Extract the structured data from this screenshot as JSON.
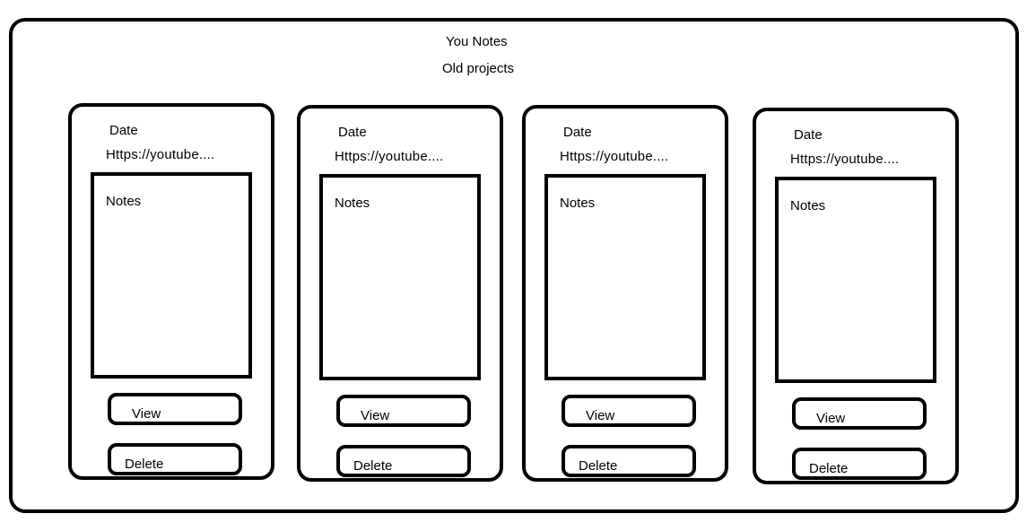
{
  "header": {
    "app_title": "You Notes",
    "section_title": "Old projects"
  },
  "cards": [
    {
      "date_label": "Date",
      "url": "Https://youtube....",
      "notes_label": "Notes",
      "view_label": "View",
      "delete_label": "Delete"
    },
    {
      "date_label": "Date",
      "url": "Https://youtube....",
      "notes_label": "Notes",
      "view_label": "View",
      "delete_label": "Delete"
    },
    {
      "date_label": "Date",
      "url": "Https://youtube....",
      "notes_label": "Notes",
      "view_label": "View",
      "delete_label": "Delete"
    },
    {
      "date_label": "Date",
      "url": "Https://youtube....",
      "notes_label": "Notes",
      "view_label": "View",
      "delete_label": "Delete"
    }
  ]
}
